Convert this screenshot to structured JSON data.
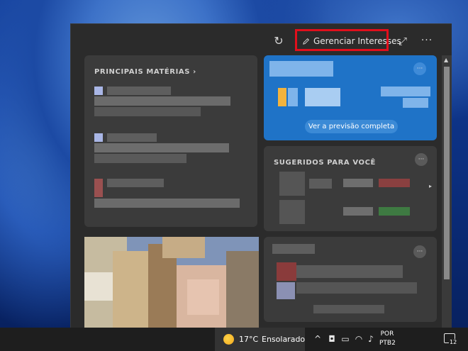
{
  "header": {
    "refresh_icon": "refresh-icon",
    "manage_label": "Gerenciar Interesses",
    "manage_icon": "pencil-icon",
    "expand_icon": "expand-icon",
    "more_label": "···"
  },
  "cards": {
    "top_stories": {
      "title": "PRINCIPAIS MATÉRIAS ›"
    },
    "weather": {
      "forecast_button": "Ver a previsão completa",
      "more_label": "···"
    },
    "suggested": {
      "title": "SUGERIDOS PARA VOCÊ",
      "more_label": "···",
      "next_arrow": "▸"
    },
    "news": {
      "more_label": "···"
    }
  },
  "taskbar": {
    "temperature": "17°C",
    "condition": "Ensolarado",
    "language_line1": "POR",
    "language_line2": "PTB2",
    "notification_count": "12",
    "colors": {
      "sun": "#f2a71b",
      "highlight": "#e10f1c",
      "weather_card": "#1f73c7"
    }
  }
}
